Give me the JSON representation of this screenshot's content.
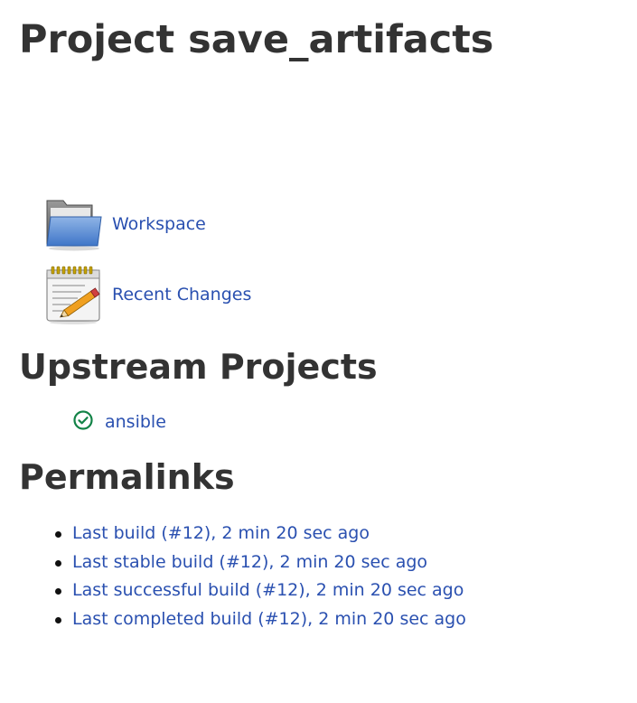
{
  "page": {
    "title": "Project save_artifacts"
  },
  "task_links": [
    {
      "label": "Workspace",
      "icon": "folder-icon"
    },
    {
      "label": "Recent Changes",
      "icon": "notepad-icon"
    }
  ],
  "upstream": {
    "heading": "Upstream Projects",
    "projects": [
      {
        "name": "ansible",
        "status": "success",
        "status_icon": "success-check-icon",
        "status_color": "#138347"
      }
    ]
  },
  "permalinks": {
    "heading": "Permalinks",
    "items": [
      "Last build (#12), 2 min 20 sec ago",
      "Last stable build (#12), 2 min 20 sec ago",
      "Last successful build (#12), 2 min 20 sec ago",
      "Last completed build (#12), 2 min 20 sec ago"
    ]
  },
  "colors": {
    "link": "#2a50b0",
    "text": "#333333",
    "background": "#ffffff"
  }
}
